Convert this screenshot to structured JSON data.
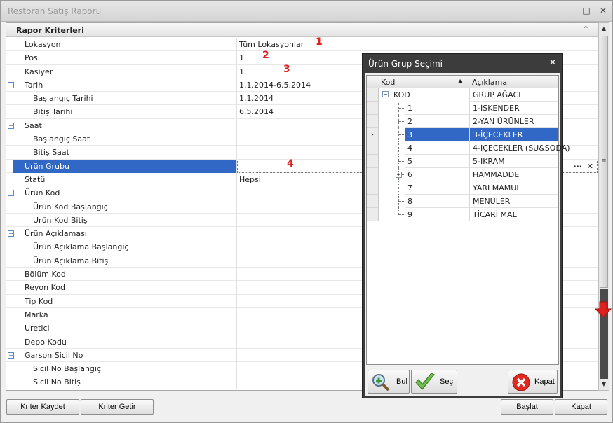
{
  "window": {
    "title": "Restoran Satış Raporu",
    "controls": {
      "minimize": "_",
      "maximize": "□",
      "close": "✕"
    }
  },
  "grid": {
    "header": "Rapor Kriterleri",
    "collapse_icon": "⌃",
    "rows": [
      {
        "label": "Lokasyon",
        "value": "Tüm Lokasyonlar",
        "level": 0,
        "marker": "1"
      },
      {
        "label": "Pos",
        "value": "1",
        "level": 0,
        "marker": "2"
      },
      {
        "label": "Kasiyer",
        "value": "1",
        "level": 0,
        "marker": "3"
      },
      {
        "label": "Tarih",
        "value": "1.1.2014-6.5.2014",
        "level": 0,
        "expander": "−"
      },
      {
        "label": "Başlangıç Tarihi",
        "value": "1.1.2014",
        "level": 1
      },
      {
        "label": "Bitiş Tarihi",
        "value": "6.5.2014",
        "level": 1
      },
      {
        "label": "Saat",
        "value": "",
        "level": 0,
        "expander": "−"
      },
      {
        "label": "Başlangıç Saat",
        "value": "",
        "level": 1
      },
      {
        "label": "Bitiş Saat",
        "value": "",
        "level": 1
      },
      {
        "label": "Ürün Grubu",
        "value": "",
        "level": 0,
        "selected": true,
        "marker": "4"
      },
      {
        "label": "Statü",
        "value": "Hepsi",
        "level": 0
      },
      {
        "label": "Ürün Kod",
        "value": "",
        "level": 0,
        "expander": "−"
      },
      {
        "label": "Ürün Kod Başlangıç",
        "value": "",
        "level": 1
      },
      {
        "label": "Ürün Kod Bitiş",
        "value": "",
        "level": 1
      },
      {
        "label": "Ürün Açıklaması",
        "value": "",
        "level": 0,
        "expander": "−"
      },
      {
        "label": "Ürün Açıklama Başlangıç",
        "value": "",
        "level": 1
      },
      {
        "label": "Ürün Açıklama Bitiş",
        "value": "",
        "level": 1
      },
      {
        "label": "Bölüm Kod",
        "value": "",
        "level": 0
      },
      {
        "label": "Reyon Kod",
        "value": "",
        "level": 0
      },
      {
        "label": "Tip Kod",
        "value": "",
        "level": 0
      },
      {
        "label": "Marka",
        "value": "",
        "level": 0
      },
      {
        "label": "Üretici",
        "value": "",
        "level": 0
      },
      {
        "label": "Depo Kodu",
        "value": "",
        "level": 0
      },
      {
        "label": "Garson Sicil No",
        "value": "",
        "level": 0,
        "expander": "−"
      },
      {
        "label": "Sicil No Başlangıç",
        "value": "",
        "level": 1
      },
      {
        "label": "Sicil No Bitiş",
        "value": "",
        "level": 1
      }
    ],
    "selected_row_buttons": {
      "ellipsis": "···",
      "clear": "✕"
    }
  },
  "footer": {
    "save_criteria": "Kriter Kaydet",
    "load_criteria": "Kriter Getir",
    "start": "Başlat",
    "close": "Kapat"
  },
  "dialog": {
    "title": "Ürün Grup Seçimi",
    "close_icon": "✕",
    "columns": {
      "code": "Kod",
      "description": "Açıklama",
      "sort_icon": "▲"
    },
    "root": {
      "code": "KOD",
      "description": "GRUP AĞACI",
      "expander": "−"
    },
    "items": [
      {
        "code": "1",
        "description": "1-İSKENDER"
      },
      {
        "code": "2",
        "description": "2-YAN ÜRÜNLER"
      },
      {
        "code": "3",
        "description": "3-İÇECEKLER",
        "selected": true,
        "indicator": "›"
      },
      {
        "code": "4",
        "description": "4-İÇECEKLER (SU&SODA)"
      },
      {
        "code": "5",
        "description": "5-IKRAM"
      },
      {
        "code": "6",
        "description": "HAMMADDE",
        "expander": "+"
      },
      {
        "code": "7",
        "description": "YARI MAMUL"
      },
      {
        "code": "8",
        "description": "MENÜLER"
      },
      {
        "code": "9",
        "description": "TİCARİ MAL"
      }
    ],
    "buttons": {
      "find": "Bul",
      "select": "Seç",
      "close": "Kapat"
    }
  },
  "colors": {
    "selection": "#3268c5",
    "marker_red": "#e0201e",
    "dialog_frame": "#3c3c3c"
  },
  "icons": {
    "find": "magnifier-plus-icon",
    "select": "checkmark-icon",
    "close": "red-x-icon",
    "scroll_indicator": "red-down-arrow-icon"
  }
}
